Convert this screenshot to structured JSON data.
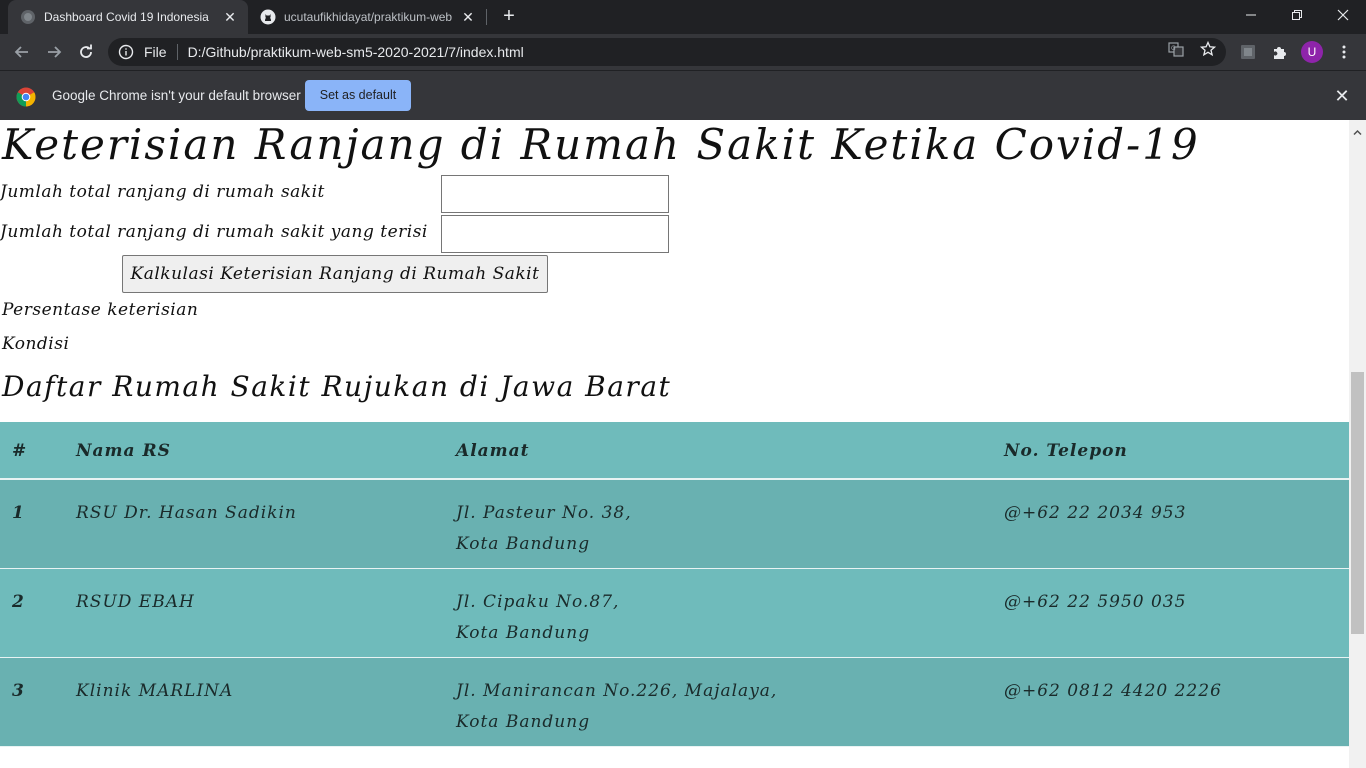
{
  "browser": {
    "tabs": [
      {
        "title": "Dashboard Covid 19 Indonesia",
        "active": true
      },
      {
        "title": "ucutaufikhidayat/praktikum-web",
        "active": false
      }
    ],
    "omnibox": {
      "scheme": "File",
      "url": "D:/Github/praktikum-web-sm5-2020-2021/7/index.html"
    },
    "profile_initial": "U",
    "infobar": {
      "message": "Google Chrome isn't your default browser",
      "button": "Set as default"
    }
  },
  "page": {
    "title": "Keterisian Ranjang di Rumah Sakit Ketika Covid-19",
    "form": {
      "total_label": "Jumlah total ranjang di rumah sakit",
      "filled_label": "Jumlah total ranjang di rumah sakit yang terisi",
      "total_value": "",
      "filled_value": "",
      "button": "Kalkulasi Keterisian Ranjang di Rumah Sakit"
    },
    "results": {
      "percentage_label": "Persentase keterisian",
      "condition_label": "Kondisi"
    },
    "list_title": "Daftar Rumah Sakit Rujukan di Jawa Barat",
    "table": {
      "headers": [
        "#",
        "Nama RS",
        "Alamat",
        "No. Telepon"
      ],
      "rows": [
        {
          "no": "1",
          "name": "RSU Dr. Hasan Sadikin",
          "address_line1": "Jl. Pasteur No. 38,",
          "address_line2": "Kota Bandung",
          "phone": "@+62 22 2034 953"
        },
        {
          "no": "2",
          "name": "RSUD EBAH",
          "address_line1": "Jl. Cipaku No.87,",
          "address_line2": "Kota Bandung",
          "phone": "@+62 22 5950 035"
        },
        {
          "no": "3",
          "name": "Klinik MARLINA",
          "address_line1": "Jl. Manirancan No.226, Majalaya,",
          "address_line2": "Kota Bandung",
          "phone": "@+62 0812 4420 2226"
        }
      ]
    }
  }
}
